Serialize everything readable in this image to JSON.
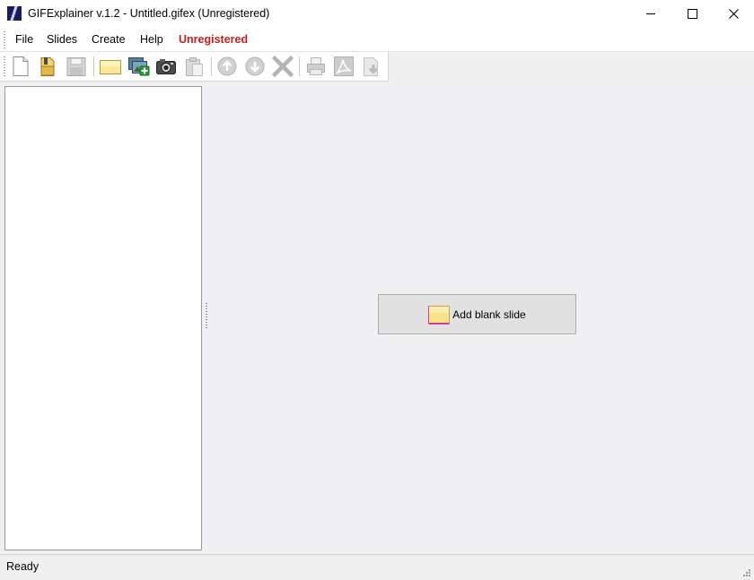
{
  "window": {
    "title": "GIFExplainer v.1.2 - Untitled.gifex (Unregistered)"
  },
  "menu": {
    "file": "File",
    "slides": "Slides",
    "create": "Create",
    "help": "Help",
    "unregistered": "Unregistered"
  },
  "toolbar": {
    "buttons": [
      {
        "icon": "new-document-icon",
        "enabled": true
      },
      {
        "icon": "open-file-icon",
        "enabled": true
      },
      {
        "icon": "save-icon",
        "enabled": false
      },
      {
        "icon": "blank-slide-icon",
        "enabled": true
      },
      {
        "icon": "add-image-icon",
        "enabled": true
      },
      {
        "icon": "camera-icon",
        "enabled": true
      },
      {
        "icon": "paste-icon",
        "enabled": false
      },
      {
        "icon": "move-up-icon",
        "enabled": false
      },
      {
        "icon": "move-down-icon",
        "enabled": false
      },
      {
        "icon": "delete-icon",
        "enabled": false
      },
      {
        "icon": "print-icon",
        "enabled": false
      },
      {
        "icon": "pdf-icon",
        "enabled": false
      },
      {
        "icon": "export-icon",
        "enabled": false
      }
    ]
  },
  "main": {
    "add_blank_slide_label": "Add blank slide"
  },
  "status": {
    "text": "Ready"
  },
  "colors": {
    "unregistered": "#c81e1e",
    "workspace_bg": "#f0eff1",
    "slide_yellow": "#f7e38a",
    "slide_accent": "#d63aa8"
  }
}
